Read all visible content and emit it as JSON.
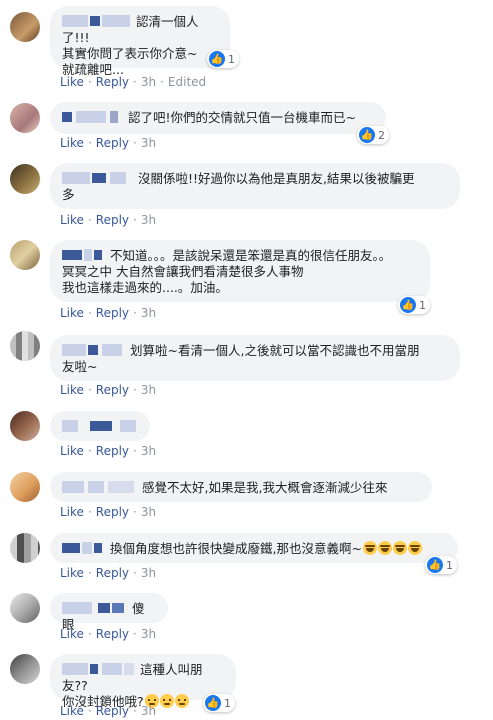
{
  "labels": {
    "like": "Like",
    "reply": "Reply",
    "separator": "·",
    "edited": "Edited"
  },
  "colors": {
    "link": "#385898",
    "bubble": "#f2f3f5",
    "like_blue": "#1877f2"
  },
  "comments": [
    {
      "name_tail": "",
      "lines": [
        "認清一個人了!!!",
        "其實你問了表示你介意~",
        "就疏離吧..."
      ],
      "time": "3h",
      "edited": true,
      "reaction_count": "1"
    },
    {
      "name_tail": "u",
      "lines": [
        "認了吧!你們的交情就只值一台機車而已~"
      ],
      "time": "3h",
      "edited": false,
      "reaction_count": "2"
    },
    {
      "name_tail": "g",
      "lines": [
        "沒關係啦!!好過你以為他是真朋友,結果以後被騙更",
        "多"
      ],
      "time": "3h",
      "edited": false,
      "reaction_count": ""
    },
    {
      "name_tail": "",
      "lines": [
        "不知道。。。是該說呆還是笨還是真的很信任朋友。。",
        "冥冥之中 大自然會讓我們看清楚很多人事物",
        "我也這樣走過來的....。加油。"
      ],
      "time": "3h",
      "edited": false,
      "reaction_count": "1"
    },
    {
      "name_tail": "",
      "lines": [
        "划算啦~看清一個人,之後就可以當不認識也不用當朋",
        "友啦~"
      ],
      "time": "3h",
      "edited": false,
      "reaction_count": ""
    },
    {
      "name_tail": "",
      "lines": [
        ""
      ],
      "time": "3h",
      "edited": false,
      "reaction_count": ""
    },
    {
      "name_tail": "ii",
      "lines": [
        "感覺不太好,如果是我,我大概會逐漸減少往來"
      ],
      "time": "3h",
      "edited": false,
      "reaction_count": ""
    },
    {
      "name_tail": "",
      "lines": [
        "換個角度想也許很快變成廢鐵,那也沒意義啊~"
      ],
      "time": "3h",
      "edited": false,
      "reaction_count": "1",
      "emojis": "laugh"
    },
    {
      "name_tail": "",
      "lines": [
        "傻眼"
      ],
      "time": "3h",
      "edited": false,
      "reaction_count": ""
    },
    {
      "name_tail": "ei",
      "lines": [
        "這種人叫朋友??",
        "你沒封鎖他哦?"
      ],
      "time": "3h",
      "edited": false,
      "reaction_count": "1",
      "emojis": "sad"
    }
  ],
  "icons": {
    "avatar": "avatar-photo",
    "like": "thumbs-up-icon",
    "laugh": "laughing-emoji-icon",
    "sad": "sad-emoji-icon"
  }
}
